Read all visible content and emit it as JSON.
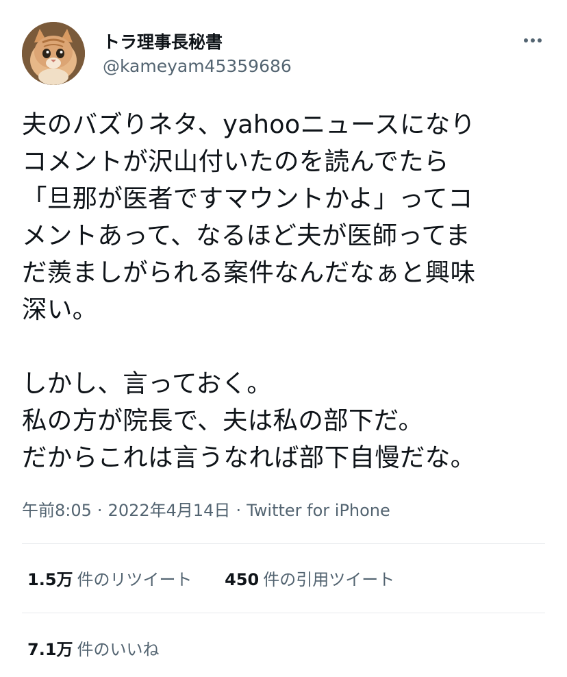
{
  "author": {
    "display_name": "トラ理事長秘書",
    "handle": "@kameyam45359686",
    "avatar": "orange-cat-photo"
  },
  "more_icon": "more-horizontal-icon",
  "tweet": {
    "lines": [
      "夫のバズりネタ、yahooニュースになり",
      "コメントが沢山付いたのを読んでたら",
      "「旦那が医者ですマウントかよ」ってコ",
      "メントあって、なるほど夫が医師ってま",
      "だ羨ましがられる案件なんだなぁと興味",
      "深い。",
      "",
      "しかし、言っておく。",
      "私の方が院長で、夫は私の部下だ。",
      "だからこれは言うなれば部下自慢だな。"
    ]
  },
  "meta": {
    "time": "午前8:05",
    "separator": "·",
    "date": "2022年4月14日",
    "client": "Twitter for iPhone"
  },
  "stats": {
    "retweets_count": "1.5万",
    "retweets_label": "件のリツイート",
    "quotes_count": "450",
    "quotes_label": "件の引用ツイート",
    "likes_count": "7.1万",
    "likes_label": "件のいいね"
  },
  "colors": {
    "text": "#0f1419",
    "secondary": "#536471",
    "divider": "#e6e9ec"
  }
}
